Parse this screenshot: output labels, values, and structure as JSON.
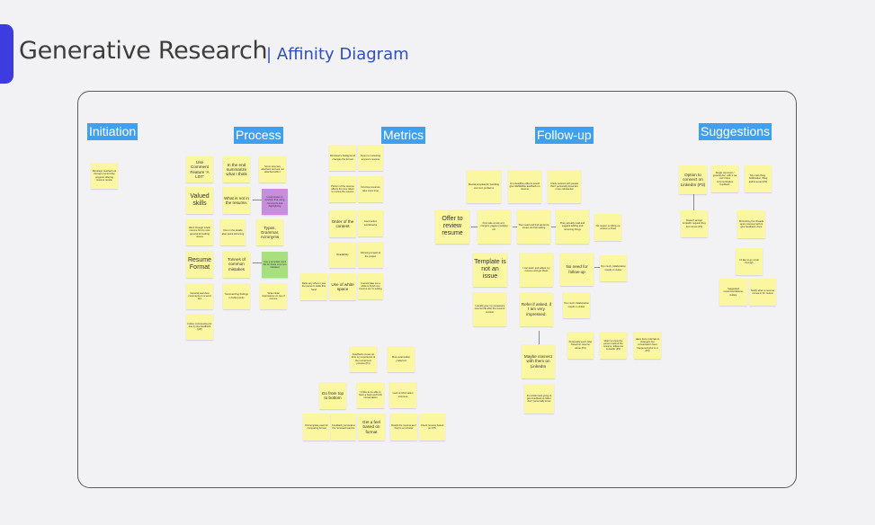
{
  "header": {
    "title": "Generative Research",
    "separator": "|",
    "subtitle": "Affinity Diagram"
  },
  "columns": {
    "initiation": "Initiation",
    "process": "Process",
    "metrics": "Metrics",
    "followup": "Follow-up",
    "suggestions": "Suggestions"
  },
  "notes": {
    "n_init1": "Reviewer reached out through mentorship program offering resume review",
    "p_comment": "Use Comment Feature 'A LOT'",
    "p_summarize": "In the end summarize what I think",
    "p_resumes_attached": "Some resumes attached, and are not attached with it",
    "p_valued": "Valued skills",
    "p_notinresume": "What is not in the resume.",
    "p_purple": "Incorporates to function that using comments and highlighting",
    "p_wentwhole": "Went through whole resume first to note general formatting issues",
    "p_dive": "Dive in the details after quick skimming",
    "p_typos": "Typos, Grammar, Acronyms",
    "p_format": "Resume Format",
    "p_tonnes": "Tonnes of common mistakes",
    "p_green": "Use a template word file for these common mistakes",
    "p_general": "General overview comments on a word doc",
    "p_summ": "Summarizing findings in bullet points",
    "p_write": "Write initial impressions on top of resume",
    "p_follow": "Follow commenting for line by line feedback (pdf)",
    "m_background": "Reviewer's background changes the format",
    "m_open": "Open to reviewing anyone's resume",
    "m_portion": "Portion of the resume affects the time taken to review the resume",
    "m_firstfew": "First few resumes take more time",
    "m_order": "Order of the content",
    "m_goodaction": "Good action words/verbs",
    "m_readability": "Readability",
    "m_showing": "Showing impact of the project",
    "m_referany": "Refer any where I see the person's skills first hand",
    "m_usewhite": "Use of white space",
    "m_itwould": "It would take me a while to finish one resume as I'm writing",
    "f_feedback": "Feedback comes up from my experience of the recruitment process (P1)",
    "f_more": "More automation preferred",
    "f_gofrom": "Go from top to bottom",
    "f_iliketo": "I'd like to be able to have a back and forth conversation",
    "f_look": "Look at information structure",
    "f_old": "Old template used for comparing format",
    "f_personal": "Feedback personal to the reviewed resume",
    "f_getfeel": "Get a feel based on format",
    "f_reads": "Reads the resume as if they're a recruiter",
    "f_check": "Check resume based on ATS",
    "u_mental": "Mental template for handling common problems",
    "u_deadline": "At a deadline officers would give GENERAL feedback on resume",
    "u_ithink": "I think reviews with people that I personally know are more substantial",
    "u_offer": "Offer to review resume",
    "u_firsttake": "First take a look at it - margins, pages (multiple) etc.",
    "u_thenread": "Then read and find sentence issues and formatting",
    "u_thenactually": "Then actually read and suggest adding and removing things",
    "u_noreason": "No reason to follow up unless re-hired",
    "u_template": "Template is not an issue",
    "u_ican": "I can learn and adjust my resume and get ideas",
    "u_nofollow": "No need for follow-up",
    "u_toomuch1": "Too much collaboration results in clutter",
    "u_iusually": "I usually give my reviewee's resume file after the resume revision",
    "u_referif": "Refer if asked, if I am very impressed.",
    "u_toomuch2": "Too much collaboration results in clutter",
    "u_personally": "Personally won't refer based on resume alone (P3)",
    "u_want": "Want to know the person behind the resume, follow via LinkedIn (P3)",
    "u_have": "Have done referrals to strangers but conversation have happened prior to it (P3)",
    "u_maybe": "Maybe connect with them on LinkedIn",
    "u_its": "It's a little hard going to give feedback to folks I don't personally know",
    "s_option": "Option to connect on LinkedIn (P3)",
    "s_single": "Single comment / general doc, with it we can't have communicative feedback",
    "s_mymain": "My main thing: Notification, iMsg and/or email (P3)",
    "s_doesnt": "Doesn't accept LinkedIn request they don't know (P3)",
    "s_minimizing": "Minimizing the threads open resumes with & give feedback, done",
    "s_idlike": "I'd like to go scroll through",
    "s_suggested": "Suggested recommendations, bullets",
    "s_notify": "Notify when a resume comes in for review"
  }
}
